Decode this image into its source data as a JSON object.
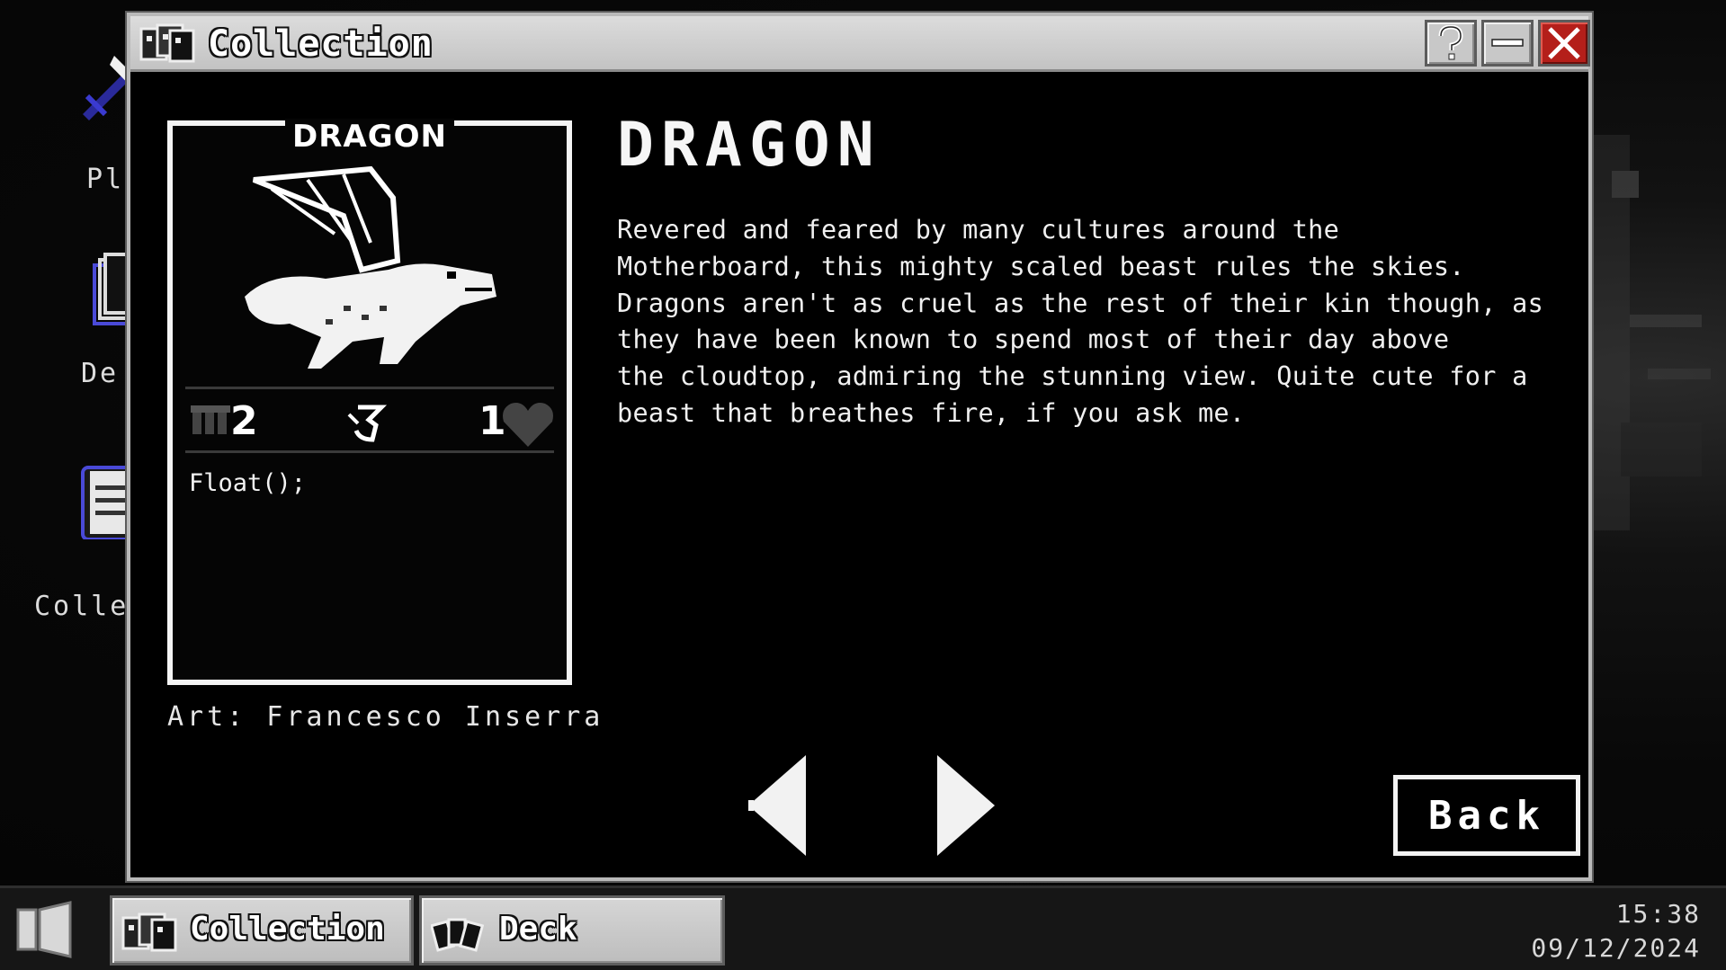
{
  "desktop": {
    "icons": [
      {
        "label": "Pl",
        "icon": "sword-icon"
      },
      {
        "label": "De",
        "icon": "deck-stack-icon"
      },
      {
        "label": "Colle",
        "icon": "book-icon"
      }
    ]
  },
  "window": {
    "title": "Collection",
    "buttons": {
      "help": "?",
      "minimize": "–",
      "close": "✕"
    }
  },
  "card": {
    "name": "DRAGON",
    "cost": "2",
    "health": "1",
    "ability": "Float();",
    "art_credit": "Art: Francesco Inserra"
  },
  "description": {
    "title": "DRAGON",
    "lines": [
      "Revered and feared by many cultures around the",
      "Motherboard, this mighty scaled beast rules the skies.",
      "Dragons aren't as cruel as the rest of their kin though, as",
      "they have been known to spend most of their day above",
      "the cloudtop, admiring the stunning view. Quite cute for a",
      "beast that breathes fire, if you ask me."
    ]
  },
  "navigation": {
    "back_label": "Back"
  },
  "taskbar": {
    "items": [
      {
        "label": "Collection"
      },
      {
        "label": "Deck"
      }
    ],
    "time": "15:38",
    "date": "09/12/2024"
  }
}
